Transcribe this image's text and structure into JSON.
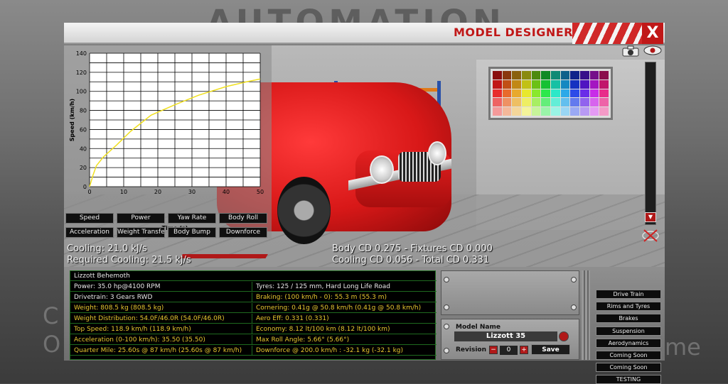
{
  "background": {
    "logo": "AUTOMATION",
    "left_text": "C\nO",
    "right_text": "me"
  },
  "window": {
    "title": "MODEL DESIGNER",
    "close_label": "X"
  },
  "graph": {
    "y_label": "Speed (km/h)",
    "x_label": "Time (s)",
    "y_ticks": [
      "0",
      "20",
      "40",
      "60",
      "80",
      "100",
      "120",
      "140"
    ],
    "x_ticks": [
      "0",
      "10",
      "20",
      "30",
      "40",
      "50"
    ],
    "buttons": [
      "Speed",
      "Power",
      "Yaw Rate",
      "Body Roll",
      "Acceleration",
      "Weight Transfer",
      "Body Bump",
      "Downforce"
    ]
  },
  "chart_data": {
    "type": "line",
    "xlabel": "Time (s)",
    "ylabel": "Speed (km/h)",
    "xlim": [
      0,
      50
    ],
    "ylim": [
      0,
      140
    ],
    "grid": true,
    "series": [
      {
        "x": [
          0,
          1,
          2,
          4,
          8,
          12,
          18,
          25,
          32,
          40,
          46,
          50
        ],
        "values": [
          0,
          12,
          22,
          31,
          44,
          58,
          75,
          86,
          96,
          105,
          110,
          113
        ]
      }
    ]
  },
  "stats": {
    "cooling": "Cooling: 21.0 kJ/s",
    "required_cooling": "Required Cooling: 21.5 kJ/s",
    "body_cd": "Body CD 0.275 - Fixtures CD 0.000",
    "cooling_cd": "Cooling CD 0.056 - Total CD 0.331"
  },
  "table": {
    "header": "Lizzott Behemoth",
    "rows": [
      {
        "left": "Power: 35.0 hp@4100 RPM",
        "left_color": "white",
        "right": "Tyres: 125 / 125 mm, Hard Long Life Road",
        "right_color": "white"
      },
      {
        "left": "Drivetrain: 3 Gears RWD",
        "left_color": "white",
        "right": "Braking: (100 km/h - 0): 55.3 m (55.3 m)",
        "right_color": "yellow"
      },
      {
        "left": "Weight: 808.5 kg (808.5 kg)",
        "left_color": "yellow",
        "right": "Cornering: 0.41g @ 50.8 km/h (0.41g @ 50.8 km/h)",
        "right_color": "yellow"
      },
      {
        "left": "Weight Distribution: 54.0F/46.0R (54.0F/46.0R)",
        "left_color": "yellow",
        "right": "Aero Eff: 0.331 (0.331)",
        "right_color": "yellow"
      },
      {
        "left": "Top Speed: 118.9 km/h (118.9 km/h)",
        "left_color": "yellow",
        "right": "Economy: 8.12 lt/100 km (8.12 lt/100 km)",
        "right_color": "yellow"
      },
      {
        "left": "Acceleration (0-100 km/h): 35.50 (35.50)",
        "left_color": "yellow",
        "right": "Max Roll Angle: 5.66° (5.66°)",
        "right_color": "yellow"
      },
      {
        "left": "Quarter Mile: 25.60s @ 87 km/h (25.60s @ 87 km/h)",
        "left_color": "yellow",
        "right": "Downforce @ 200.0 km/h : -32.1 kg (-32.1 kg)",
        "right_color": "yellow"
      }
    ]
  },
  "model": {
    "name_label": "Model Name",
    "name_value": "Lizzott 35",
    "revision_label": "Revision",
    "revision_value": "0",
    "save_label": "Save"
  },
  "side_menu": [
    "Drive Train",
    "Rims and Tyres",
    "Brakes",
    "Suspension",
    "Aerodynamics",
    "Coming Soon",
    "Coming Soon",
    "TESTING"
  ],
  "colors": {
    "accent_red": "#c01818",
    "graph_line": "#f0e020",
    "stat_yellow": "#e8c830",
    "table_border": "#1f6a1f"
  },
  "icons": [
    "camera-icon",
    "eye-icon",
    "scroll-up-icon",
    "scroll-down-icon",
    "hide-view-icon",
    "clear-name-icon"
  ]
}
